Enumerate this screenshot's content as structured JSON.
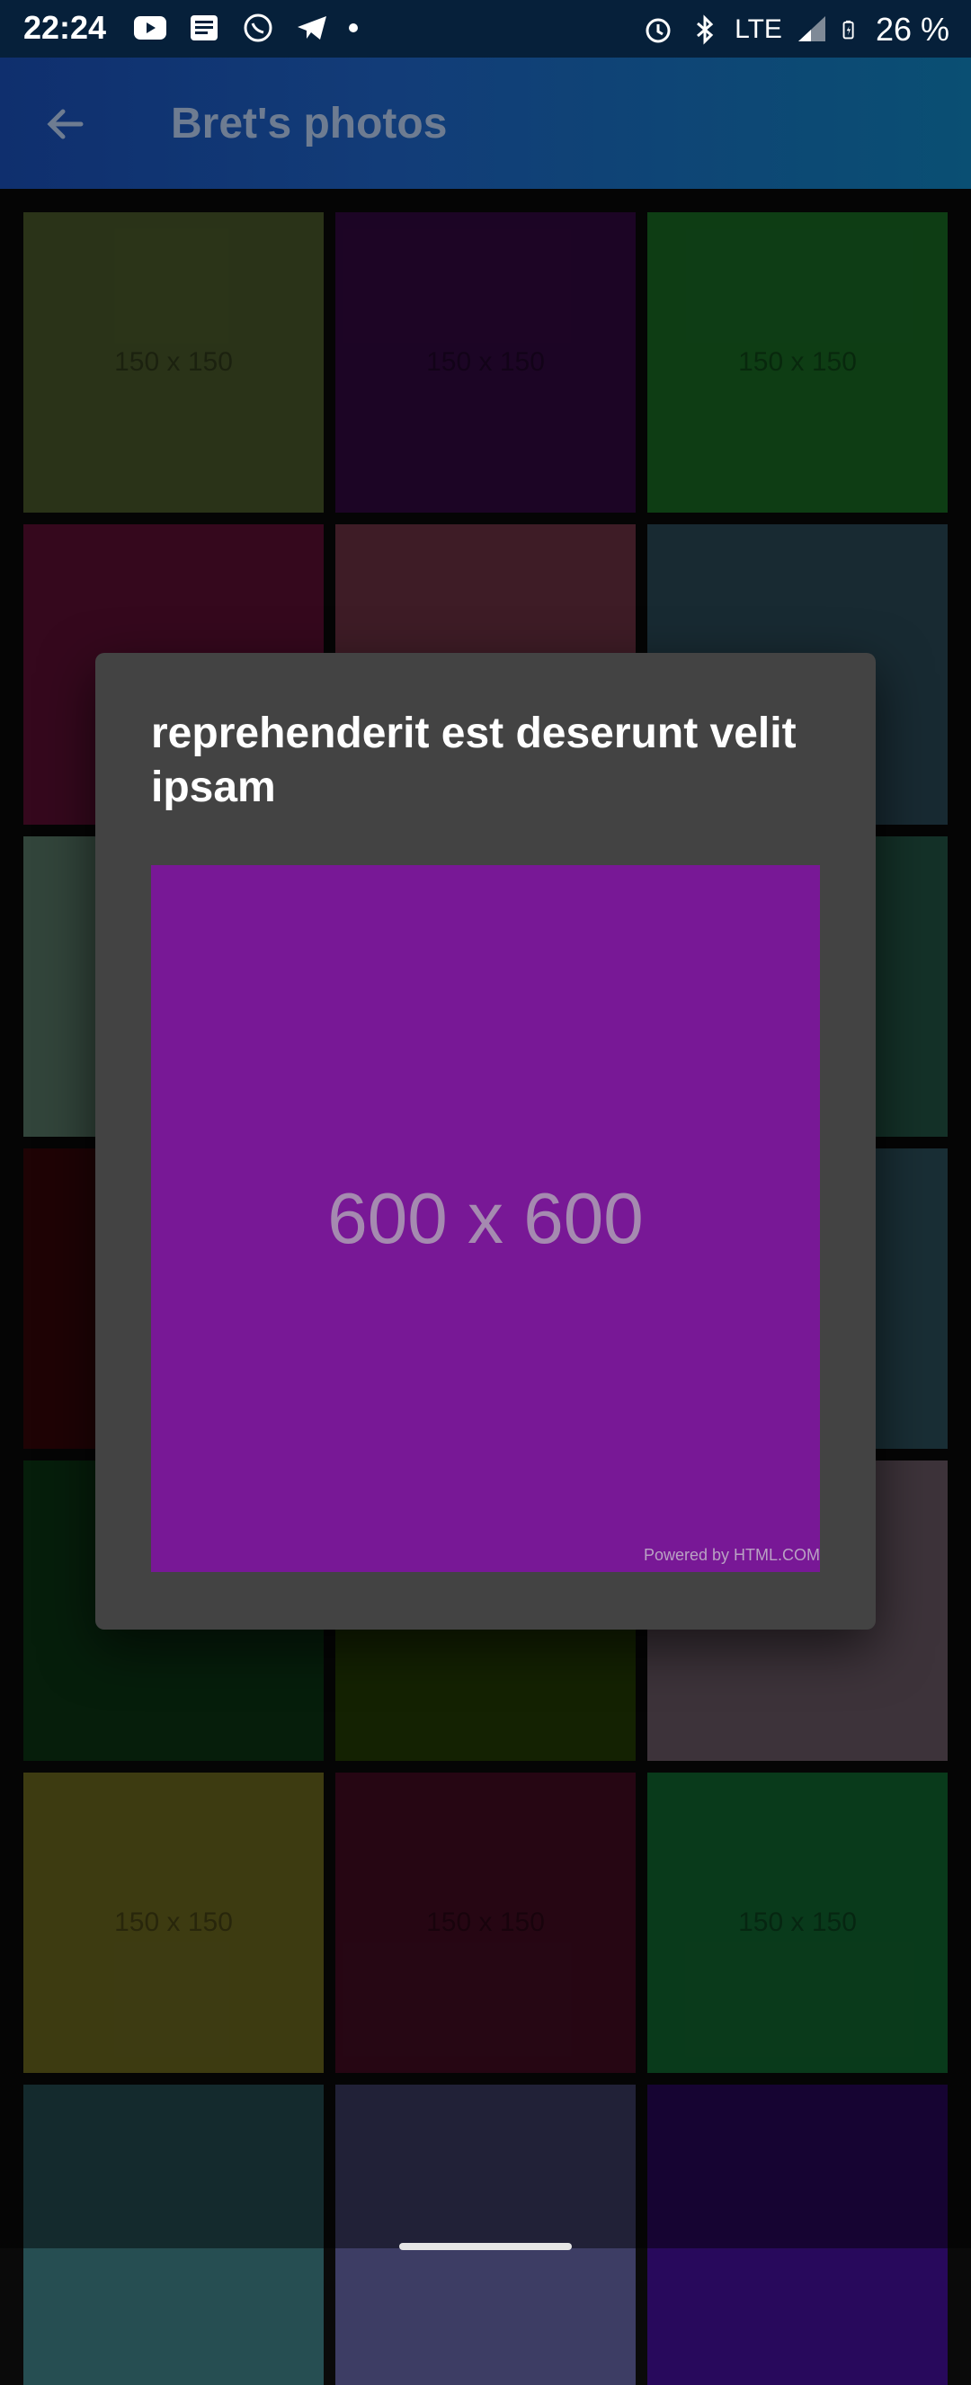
{
  "status_bar": {
    "time": "22:24",
    "network": "LTE",
    "battery": "26 %",
    "left_icons": [
      "youtube-icon",
      "news-icon",
      "whatsapp-icon",
      "telegram-icon",
      "more-dot-icon"
    ],
    "right_icons": [
      "alarm-icon",
      "bluetooth-icon",
      "signal-icon",
      "battery-icon"
    ]
  },
  "appbar": {
    "title": "Bret's photos",
    "back_icon": "arrow-back-icon",
    "gradient": [
      "#0f2f6e",
      "#0a4f73"
    ]
  },
  "grid": {
    "tiles": [
      {
        "label": "150 x 150",
        "color": "#4e5e2c"
      },
      {
        "label": "150 x 150",
        "color": "#340a44"
      },
      {
        "label": "150 x 150",
        "color": "#1a7026"
      },
      {
        "label": "",
        "color": "#620f36"
      },
      {
        "label": "",
        "color": "#723346"
      },
      {
        "label": "",
        "color": "#2c4e5c"
      },
      {
        "label": "",
        "color": "#5c7e6c"
      },
      {
        "label": "",
        "color": "#2b2b2b"
      },
      {
        "label": "",
        "color": "#265a4a"
      },
      {
        "label": "",
        "color": "#3a060a"
      },
      {
        "label": "",
        "color": "#2b2b2b"
      },
      {
        "label": "",
        "color": "#2e5462"
      },
      {
        "label": "",
        "color": "#0b3714"
      },
      {
        "label": "",
        "color": "#263f04"
      },
      {
        "label": "",
        "color": "#705e6a"
      },
      {
        "label": "150 x 150",
        "color": "#706c20"
      },
      {
        "label": "150 x 150",
        "color": "#460c24"
      },
      {
        "label": "150 x 150",
        "color": "#126a32"
      },
      {
        "label": "",
        "color": "#264e52"
      },
      {
        "label": "",
        "color": "#3d3d64"
      },
      {
        "label": "",
        "color": "#28095c"
      }
    ]
  },
  "dialog": {
    "title": "reprehenderit est deserunt velit ipsam",
    "photo": {
      "label": "600 x 600",
      "color": "#781896",
      "credit": "Powered by HTML.COM"
    }
  }
}
